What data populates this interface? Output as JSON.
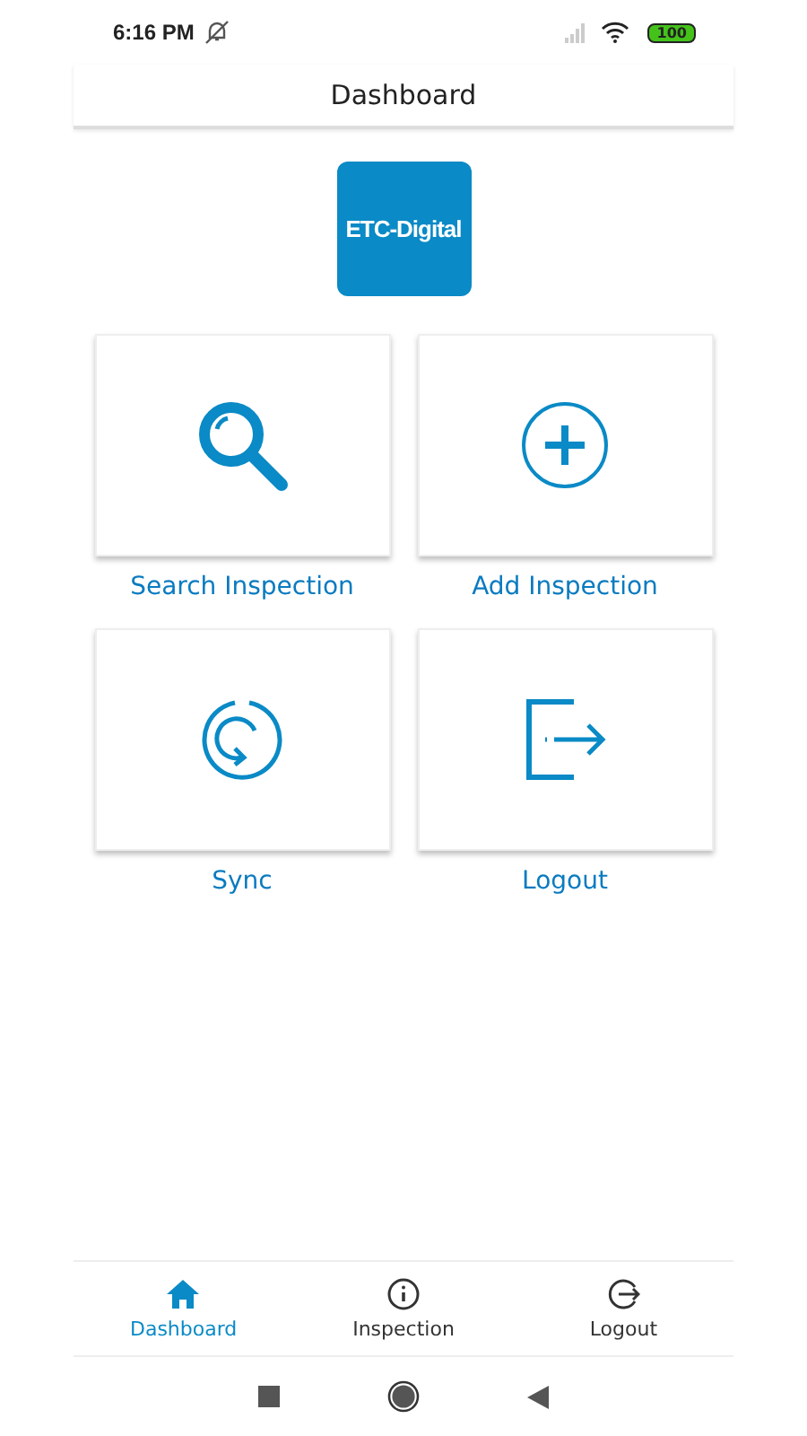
{
  "status_bar": {
    "time": "6:16 PM",
    "battery": "100"
  },
  "header": {
    "title": "Dashboard"
  },
  "logo": {
    "text": "ETC-Digital"
  },
  "tiles": [
    {
      "kind": "search",
      "label": "Search Inspection"
    },
    {
      "kind": "add",
      "label": "Add Inspection"
    },
    {
      "kind": "sync",
      "label": "Sync"
    },
    {
      "kind": "logout",
      "label": "Logout"
    }
  ],
  "bottom_nav": [
    {
      "kind": "home",
      "label": "Dashboard",
      "selected": true
    },
    {
      "kind": "info",
      "label": "Inspection",
      "selected": false
    },
    {
      "kind": "logout",
      "label": "Logout",
      "selected": false
    }
  ]
}
